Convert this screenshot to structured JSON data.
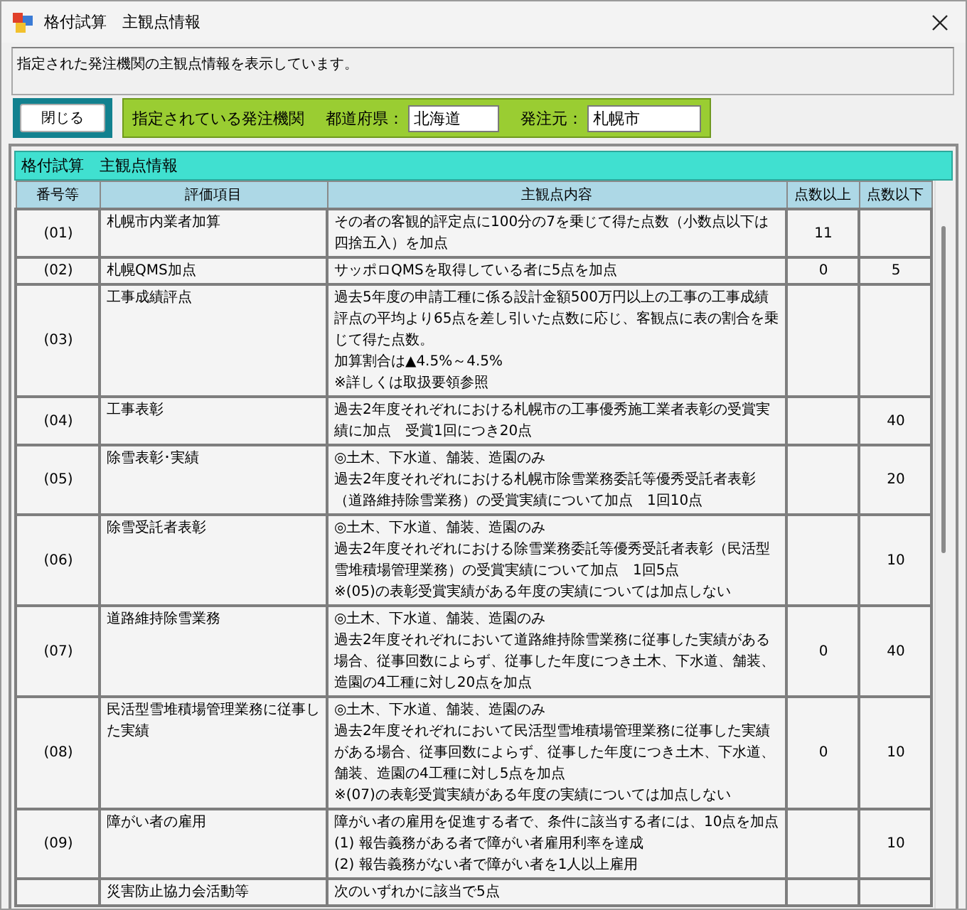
{
  "window": {
    "title": "格付試算　主観点情報"
  },
  "message": "指定された発注機関の主観点情報を表示しています。",
  "close_button": "閉じる",
  "agency_panel": {
    "label": "指定されている発注機関",
    "prefecture_label": "都道府県：",
    "prefecture": "北海道",
    "orderer_label": "発注元：",
    "orderer": "札幌市"
  },
  "table": {
    "title": "格付試算　主観点情報",
    "columns": [
      "番号等",
      "評価項目",
      "主観点内容",
      "点数以上",
      "点数以下"
    ],
    "rows": [
      {
        "number": "(01)",
        "item": "札幌市内業者加算",
        "content": "その者の客観的評定点に100分の7を乗じて得た点数（小数点以下は四捨五入）を加点",
        "min": "11"
      },
      {
        "number": "(02)",
        "item": "札幌QMS加点",
        "content": "サッポロQMSを取得している者に5点を加点",
        "min": "0",
        "max": "5"
      },
      {
        "number": "(03)",
        "item": "工事成績評点",
        "content": [
          "過去5年度の申請工種に係る設計金額500万円以上の工事の工事成績評点の平均より65点を差し引いた点数に応じ、客観点に表の割合を乗じて得た点数。",
          "加算割合は▲4.5%～4.5%",
          "※詳しくは取扱要領参照"
        ]
      },
      {
        "number": "(04)",
        "item": "工事表彰",
        "content": "過去2年度それぞれにおける札幌市の工事優秀施工業者表彰の受賞実績に加点　受賞1回につき20点",
        "max": "40"
      },
      {
        "number": "(05)",
        "item": "除雪表彰･実績",
        "content": [
          "◎土木、下水道、舗装、造園のみ",
          "過去2年度それぞれにおける札幌市除雪業務委託等優秀受託者表彰（道路維持除雪業務）の受賞実績について加点　1回10点"
        ],
        "max": "20"
      },
      {
        "number": "(06)",
        "item": "除雪受託者表彰",
        "content": [
          "◎土木、下水道、舗装、造園のみ",
          "過去2年度それぞれにおける除雪業務委託等優秀受託者表彰（民活型雪堆積場管理業務）の受賞実績について加点　1回5点",
          "※(05)の表彰受賞実績がある年度の実績については加点しない"
        ],
        "max": "10"
      },
      {
        "number": "(07)",
        "item": "道路維持除雪業務",
        "content": [
          "◎土木、下水道、舗装、造園のみ",
          "過去2年度それぞれにおいて道路維持除雪業務に従事した実績がある場合、従事回数によらず、従事した年度につき土木、下水道、舗装、造園の4工種に対し20点を加点"
        ],
        "min": "0",
        "max": "40"
      },
      {
        "number": "(08)",
        "item": "民活型雪堆積場管理業務に従事した実績",
        "content": [
          "◎土木、下水道、舗装、造園のみ",
          "過去2年度それぞれにおいて民活型雪堆積場管理業務に従事した実績がある場合、従事回数によらず、従事した年度につき土木、下水道、舗装、造園の4工種に対し5点を加点",
          "※(07)の表彰受賞実績がある年度の実績については加点しない"
        ],
        "min": "0",
        "max": "10"
      },
      {
        "number": "(09)",
        "item": "障がい者の雇用",
        "content": [
          "障がい者の雇用を促進する者で、条件に該当する者には、10点を加点",
          "(1) 報告義務がある者で障がい者雇用利率を達成",
          "(2) 報告義務がない者で障がい者を1人以上雇用"
        ],
        "max": "10"
      },
      {
        "item": "災害防止協力会活動等",
        "content": "次のいずれかに該当で5点"
      }
    ]
  }
}
